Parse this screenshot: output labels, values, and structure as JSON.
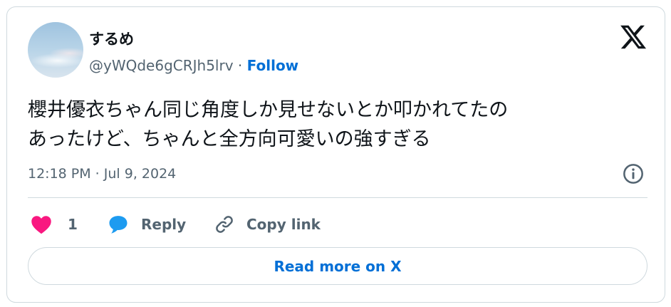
{
  "author": {
    "name": "するめ",
    "handle": "@yWQde6gCRJh5lrv",
    "separator": "·",
    "follow_label": "Follow"
  },
  "tweet": {
    "lines": [
      "櫻井優衣ちゃん同じ角度しか見せないとか叩かれてたの",
      "あったけど、ちゃんと全方向可愛いの強すぎる"
    ],
    "timestamp": "12:18 PM · Jul 9, 2024"
  },
  "actions": {
    "like_count": "1",
    "reply_label": "Reply",
    "copy_link_label": "Copy link"
  },
  "read_more_label": "Read more on X",
  "icons": {
    "logo": "x-logo-icon",
    "info": "info-icon",
    "like": "heart-icon",
    "reply": "speech-bubble-icon",
    "copy": "link-icon"
  },
  "colors": {
    "link": "#006fd6",
    "heart": "#f91880",
    "reply_bubble": "#1d9bf0",
    "secondary_text": "#536471",
    "border": "#cfd9de"
  }
}
